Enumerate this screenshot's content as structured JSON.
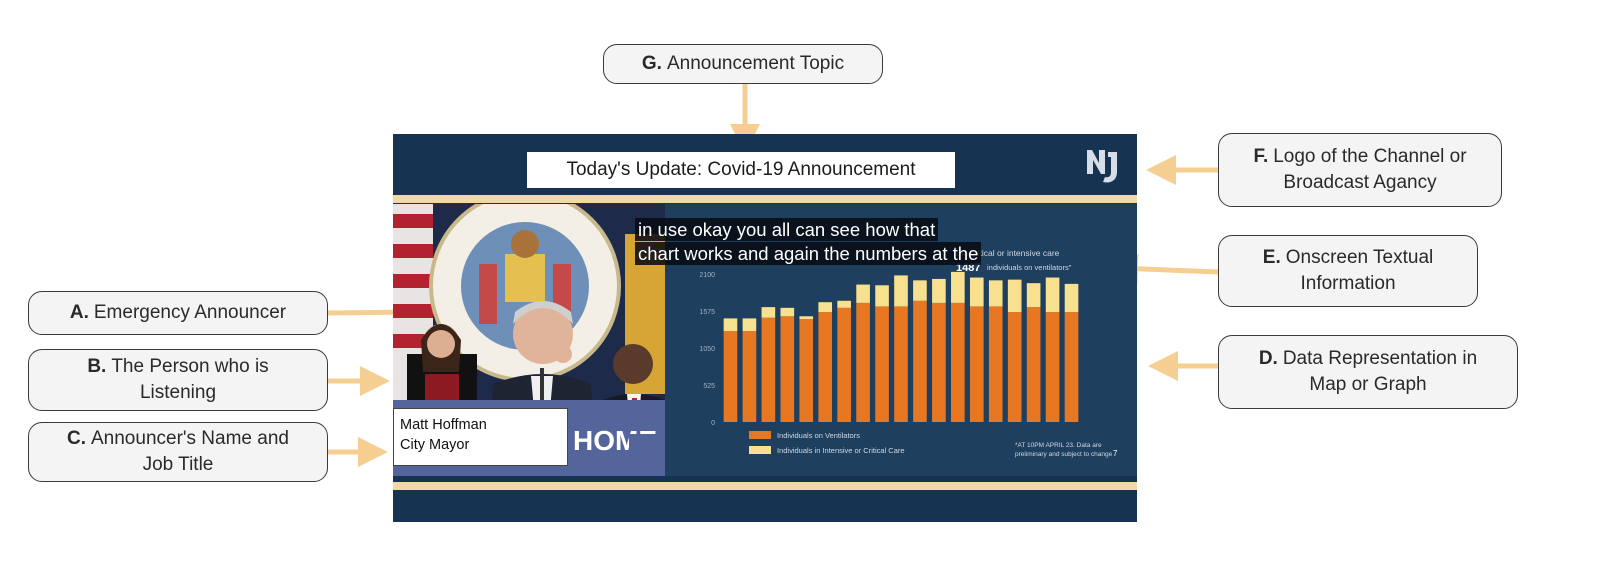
{
  "callouts": {
    "g": {
      "letter": "G.",
      "text": "Announcement Topic"
    },
    "f": {
      "letter": "F.",
      "line1": "Logo of the Channel or",
      "line2": "Broadcast Agancy"
    },
    "e": {
      "letter": "E.",
      "line1": "Onscreen Textual",
      "line2": "Information"
    },
    "d": {
      "letter": "D.",
      "line1": "Data Representation in",
      "line2": "Map or Graph"
    },
    "a": {
      "letter": "A.",
      "text": "Emergency Announcer"
    },
    "b": {
      "letter": "B.",
      "line1": "The Person who is",
      "line2": "Listening"
    },
    "c": {
      "letter": "C.",
      "line1": "Announcer's Name and",
      "line2": "Job Title"
    }
  },
  "screen": {
    "topic": "Today's Update: Covid-19 Announcement",
    "caption_line1": "in use okay you all can see how that",
    "caption_line2": "chart works and again the numbers at the",
    "name": "Matt Hoffman",
    "job_title": "City Mayor",
    "podium_text": "HOME",
    "chart_note": "s in critical or intensive care",
    "chart_highlight": "1487",
    "chart_highlight_text": "individuals on ventilators\"",
    "footnote_line1": "*AT 10PM APRIL 23. Data are",
    "footnote_line2": "preliminary and subject to change",
    "page_number": "7"
  },
  "chart_data": {
    "type": "bar",
    "stacked": true,
    "ylim": [
      0,
      2100
    ],
    "yticks": [
      "2100",
      "1575",
      "1050",
      "525",
      "0"
    ],
    "series": [
      {
        "name": "Individuals on Ventilators",
        "color": "#e87722",
        "values": [
          1290,
          1290,
          1480,
          1500,
          1460,
          1560,
          1620,
          1690,
          1640,
          1640,
          1720,
          1690,
          1690,
          1640,
          1640,
          1560,
          1630,
          1560,
          1560
        ]
      },
      {
        "name": "Individuals in Intensive or Critical Care",
        "color": "#f7e08e",
        "values": [
          180,
          180,
          150,
          120,
          40,
          140,
          100,
          260,
          300,
          440,
          290,
          340,
          440,
          410,
          370,
          460,
          340,
          490,
          400
        ]
      }
    ],
    "colors": {
      "accent": "#f2d8a2",
      "frame": "#163352",
      "arrow": "#f5cf91"
    }
  }
}
